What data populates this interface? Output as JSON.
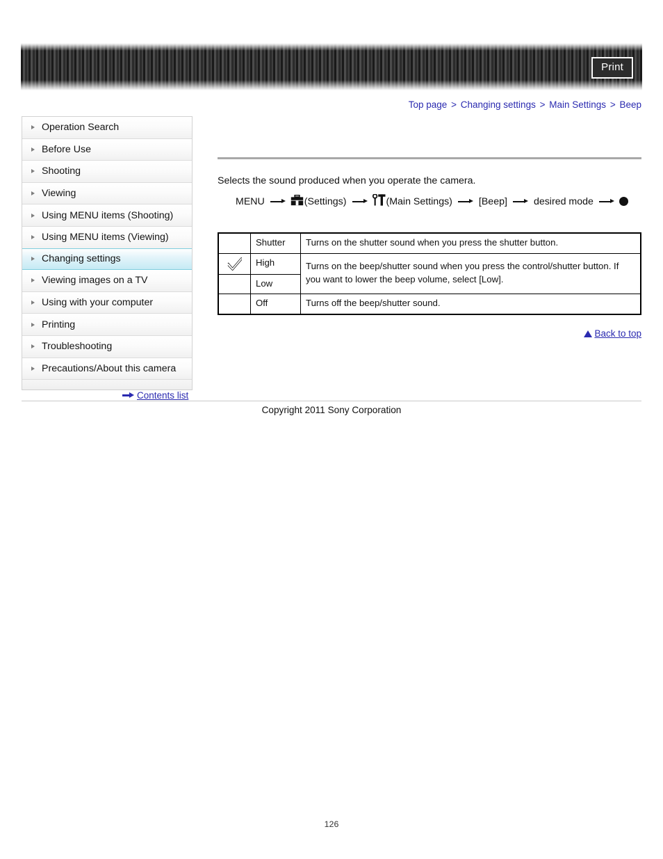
{
  "header": {
    "print_label": "Print",
    "banner_icon": "striped-banner"
  },
  "breadcrumb": {
    "separator": ">",
    "items": [
      {
        "label": "Top page"
      },
      {
        "label": "Changing settings"
      },
      {
        "label": "Main Settings"
      },
      {
        "label": "Beep"
      }
    ]
  },
  "sidebar": {
    "items": [
      {
        "label": "Operation Search",
        "active": false
      },
      {
        "label": "Before Use",
        "active": false
      },
      {
        "label": "Shooting",
        "active": false
      },
      {
        "label": "Viewing",
        "active": false
      },
      {
        "label": "Using MENU items (Shooting)",
        "active": false
      },
      {
        "label": "Using MENU items (Viewing)",
        "active": false
      },
      {
        "label": "Changing settings",
        "active": true
      },
      {
        "label": "Viewing images on a TV",
        "active": false
      },
      {
        "label": "Using with your computer",
        "active": false
      },
      {
        "label": "Printing",
        "active": false
      },
      {
        "label": "Troubleshooting",
        "active": false
      },
      {
        "label": "Precautions/About this camera",
        "active": false
      }
    ],
    "contents_list_label": "Contents list"
  },
  "main": {
    "intro": "Selects the sound produced when you operate the camera.",
    "menu_path": {
      "start": "MENU",
      "settings_label": "(Settings)",
      "main_settings_label": "(Main Settings)",
      "item_label": "[Beep]",
      "mode_label": "desired mode",
      "settings_icon": "toolbox-icon",
      "main_settings_icon": "wrench-screwdriver-icon",
      "confirm_icon": "center-button-dot-icon"
    },
    "table": {
      "check_icon": "default-check-icon",
      "rows": [
        {
          "checked": false,
          "name": "Shutter",
          "desc": "Turns on the shutter sound when you press the shutter button.",
          "desc_rowspan": 1
        },
        {
          "checked": true,
          "name": "High",
          "desc": "Turns on the beep/shutter sound when you press the control/shutter button. If you want to lower the beep volume, select [Low].",
          "desc_rowspan": 2
        },
        {
          "checked": false,
          "name": "Low",
          "desc": null,
          "desc_rowspan": 0
        },
        {
          "checked": false,
          "name": "Off",
          "desc": "Turns off the beep/shutter sound.",
          "desc_rowspan": 1
        }
      ]
    },
    "back_to_top_label": "Back to top"
  },
  "footer": {
    "copyright": "Copyright 2011 Sony Corporation",
    "page_number": "126"
  },
  "colors": {
    "link": "#2a2ab0",
    "active_item": "#c5eaf4",
    "active_border": "#7fcede",
    "rule": "#a8a8a8"
  }
}
